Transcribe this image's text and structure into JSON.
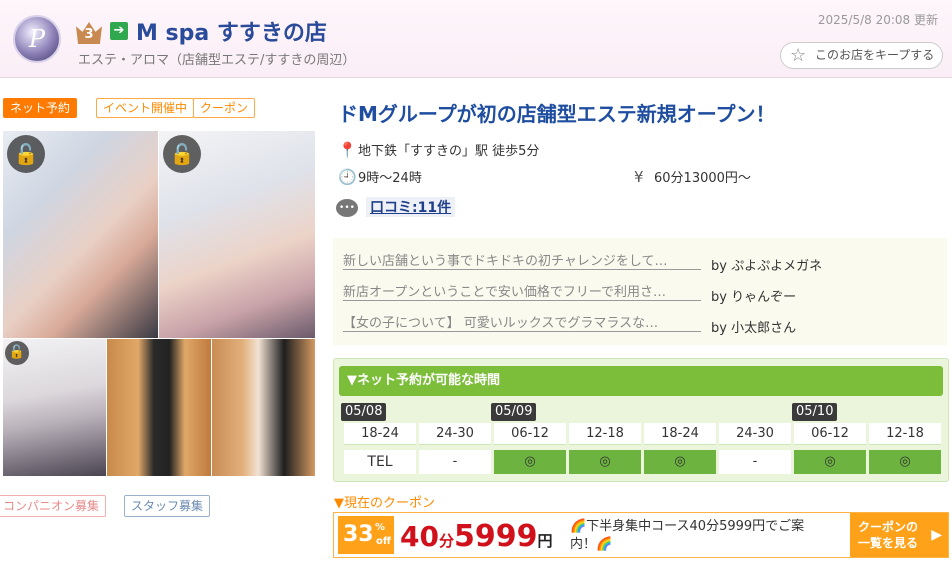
{
  "header": {
    "logo_letter": "P",
    "rank": "3",
    "enter_icon": "➔",
    "shop_name": "M spa すすきの店",
    "shop_sub": "エステ・アロマ（店舗型エステ/すすきの周辺）",
    "updated": "2025/5/8 20:08 更新",
    "keep_label": "このお店をキープする"
  },
  "tags": {
    "net": "ネット予約",
    "event": "イベント開催中",
    "coupon": "クーポン"
  },
  "recruit": {
    "companion": "コンパニオン募集",
    "staff": "スタッフ募集"
  },
  "main": {
    "headline": "ドMグループが初の店舗型エステ新規オープン！",
    "access": "地下鉄「すすきの」駅 徒歩5分",
    "hours": "9時～24時",
    "price": "60分13000円～",
    "review_link": "口コミ:11件"
  },
  "reviews": [
    {
      "text": "新しい店舗という事でドキドキの初チャレンジをして…",
      "by": "by ぷよぷよメガネ"
    },
    {
      "text": "新店オープンということで安い価格でフリーで利用さ…",
      "by": "by りゃんぞー"
    },
    {
      "text": "【女の子について】 可愛いルックスでグラマラスな…",
      "by": "by 小太郎さん"
    }
  ],
  "reservation": {
    "title": "▼ネット予約が可能な時間",
    "dates": [
      "05/08",
      "05/09",
      "05/10"
    ],
    "slots": [
      {
        "time": "18-24",
        "value": "TEL"
      },
      {
        "time": "24-30",
        "value": "-"
      },
      {
        "time": "06-12",
        "value": "◎"
      },
      {
        "time": "12-18",
        "value": "◎"
      },
      {
        "time": "18-24",
        "value": "◎"
      },
      {
        "time": "24-30",
        "value": "-"
      },
      {
        "time": "06-12",
        "value": "◎"
      },
      {
        "time": "12-18",
        "value": "◎"
      }
    ]
  },
  "coupon": {
    "section_title": "▼現在のクーポン",
    "off_number": "33",
    "off_unit": "%",
    "off_label": "off",
    "price_minutes": "40",
    "price_minutes_unit": "分",
    "price_yen": "5999",
    "price_yen_unit": "円",
    "description": "🌈下半身集中コース40分5999円でご案内！🌈",
    "list_button_line1": "クーポンの",
    "list_button_line2": "一覧を見る",
    "list_button_arrow": "▶"
  },
  "colors": {
    "accent_blue": "#1f4ea0",
    "net_orange": "#ff7a00",
    "reserve_green": "#7cbd3a",
    "coupon_red": "#d0101a"
  }
}
